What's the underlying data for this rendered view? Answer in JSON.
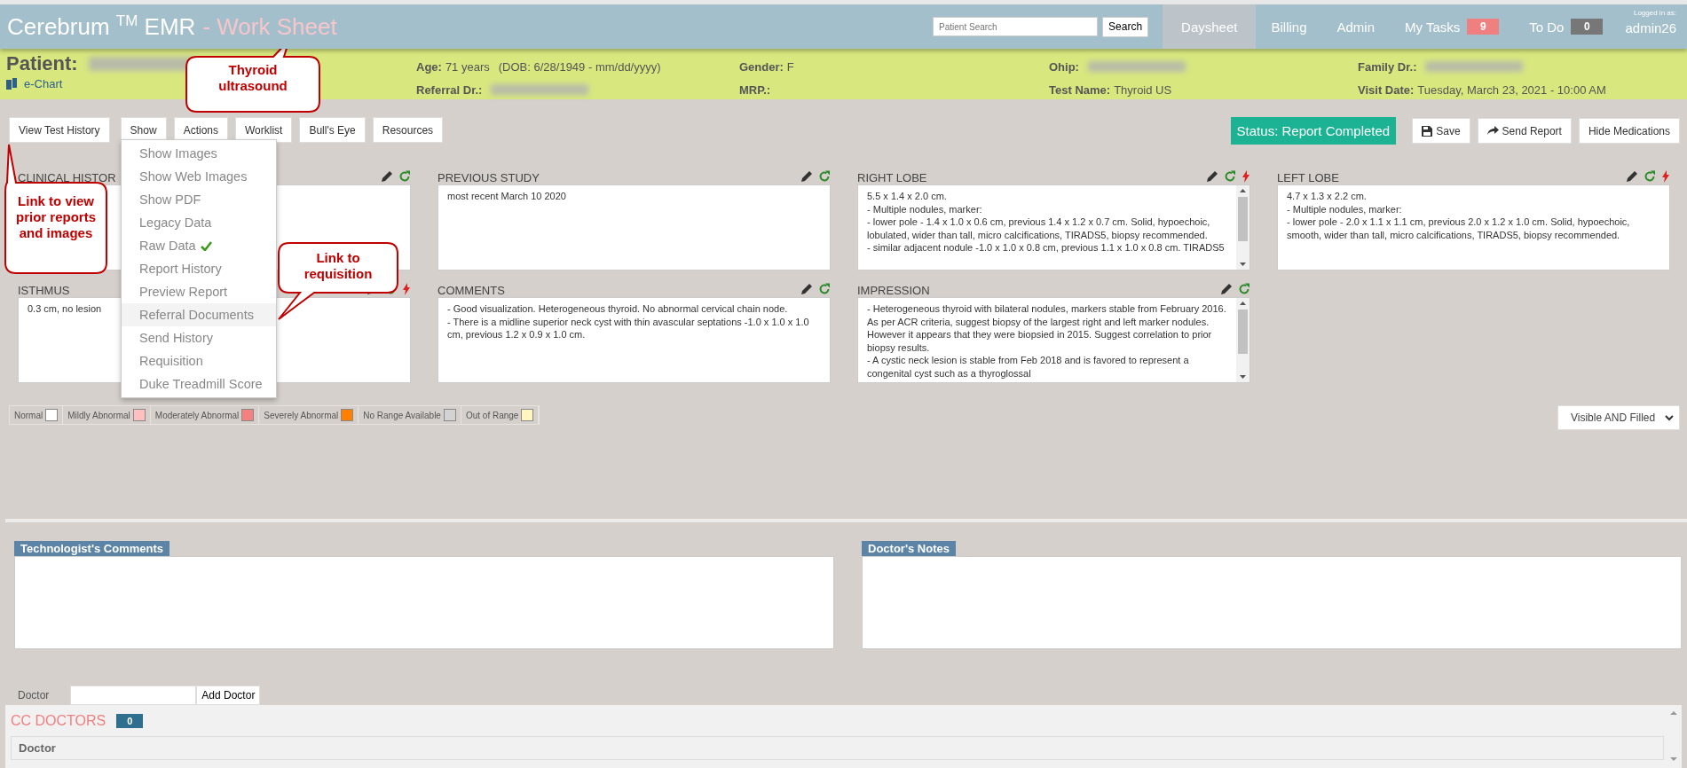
{
  "header": {
    "brand": "Cerebrum",
    "trademark": "TM",
    "product": "EMR",
    "page_title": "- Work Sheet",
    "search": {
      "placeholder": "Patient Search",
      "button": "Search"
    },
    "nav": [
      {
        "label": "Daysheet",
        "selected": true
      },
      {
        "label": "Billing",
        "selected": false
      },
      {
        "label": "Admin",
        "selected": false
      },
      {
        "label": "My Tasks",
        "selected": false,
        "badge": "9",
        "color": "#f08080"
      },
      {
        "label": "To Do",
        "selected": false,
        "badge": "0",
        "color": "#777777"
      }
    ],
    "login_caption": "Logged in as:",
    "user": "admin26"
  },
  "patient": {
    "label": "Patient:",
    "echart": "e-Chart",
    "fields": [
      {
        "label": "Age:",
        "value": "71 years",
        "extra": "(DOB: 6/28/1949 - mm/dd/yyyy)"
      },
      {
        "label": "Gender:",
        "value": "F"
      },
      {
        "label": "Ohip:",
        "redacted": true
      },
      {
        "label": "Family Dr.:",
        "redacted": true
      },
      {
        "label": "Referral Dr.:",
        "redacted": true
      },
      {
        "label": "MRP.:"
      },
      {
        "label": "Test Name:",
        "value": "Thyroid US"
      },
      {
        "label": "Visit Date:",
        "value": "Tuesday, March 23, 2021 - 10:00 AM"
      }
    ]
  },
  "toolbar": {
    "left": [
      "View Test History",
      "Show",
      "Actions",
      "Worklist",
      "Bull's Eye",
      "Resources"
    ],
    "status": "Status: Report Completed",
    "right": [
      "Save",
      "Send Report",
      "Hide Medications"
    ]
  },
  "show_menu": [
    {
      "label": "Show Images",
      "selected": false
    },
    {
      "label": "Show Web Images",
      "selected": false
    },
    {
      "label": "Show PDF",
      "selected": false
    },
    {
      "label": "Legacy Data",
      "selected": false
    },
    {
      "label": "Raw Data",
      "selected": false,
      "checked": true
    },
    {
      "label": "Report History",
      "selected": false
    },
    {
      "label": "Preview Report",
      "selected": false
    },
    {
      "label": "Referral Documents",
      "selected": true
    },
    {
      "label": "Send History",
      "selected": false
    },
    {
      "label": "Requisition",
      "selected": false
    },
    {
      "label": "Duke Treadmill Score",
      "selected": false
    }
  ],
  "panels": [
    {
      "title": "CLINICAL HISTOR",
      "alert": false,
      "scrollbar": false
    },
    {
      "title": "PREVIOUS STUDY",
      "alert": false,
      "scrollbar": false,
      "text": "most recent March 10 2020"
    },
    {
      "title": "RIGHT LOBE",
      "alert": true,
      "scrollbar": true,
      "text": "5.5 x 1.4 x 2.0 cm.\n- Multiple nodules, marker:\n- lower  pole - 1.4 x 1.0 x 0.6 cm, previous 1.4 x 1.2 x 0.7 cm. Solid, hypoechoic, lobulated, wider than tall, micro calcifications, TIRADS5, biopsy recommended.\n- similar adjacent nodule -1.0 x 1.0 x 0.8 cm, previous 1.1 x 1.0 x 0.8 cm. TIRADS5"
    },
    {
      "title": "LEFT LOBE",
      "alert": true,
      "scrollbar": false,
      "text": "4.7 x 1.3 x 2.2 cm.\n- Multiple nodules, marker:\n- lower  pole - 2.0 x 1.1 x 1.1 cm, previous 2.0 x 1.2 x 1.0 cm. Solid, hypoechoic, smooth, wider than tall, micro calcifications, TIRADS5, biopsy  recommended."
    },
    {
      "title": "ISTHMUS",
      "alert": true,
      "scrollbar": false,
      "text": "0.3 cm, no lesion"
    },
    {
      "title": "COMMENTS",
      "alert": false,
      "scrollbar": false,
      "text": "- Good visualization.  Heterogeneous thyroid.  No abnormal cervical chain node.\n- There is a midline superior neck cyst with thin avascular septations -1.0 x 1.0 x 1.0 cm, previous 1.2 x 0.9 x 1.0 cm."
    },
    {
      "title": "IMPRESSION",
      "alert": false,
      "scrollbar": true,
      "text": "- Heterogeneous thyroid with bilateral nodules, markers stable from February 2016. As per ACR criteria, suggest biopsy of the largest right and left marker nodules. However it appears that they were biopsied in 2015. Suggest  correlation to prior biopsy results.\n- A cystic neck lesion is stable from Feb 2018 and is favored to represent a congenital cyst such as a thyroglossal"
    }
  ],
  "legend": [
    {
      "label": "Normal",
      "color": "#ffffff"
    },
    {
      "label": "Mildly Abnormal",
      "color": "#ffc0c0"
    },
    {
      "label": "Moderately Abnormal",
      "color": "#f58080"
    },
    {
      "label": "Severely Abnormal",
      "color": "#ff8000"
    },
    {
      "label": "No Range Available",
      "color": "#d3d3d3"
    },
    {
      "label": "Out of Range",
      "color": "#fff5c0"
    }
  ],
  "filter_select": "Visible AND Filled",
  "notes": [
    "Technologist's Comments",
    "Doctor's Notes"
  ],
  "doctor": {
    "label": "Doctor",
    "button": "Add Doctor"
  },
  "cc_doctors": {
    "title": "CC DOCTORS",
    "count": "0",
    "column": "Doctor"
  },
  "callouts": [
    "Thyroid ultrasound",
    "Link to view prior reports and images",
    "Link to requisition"
  ]
}
